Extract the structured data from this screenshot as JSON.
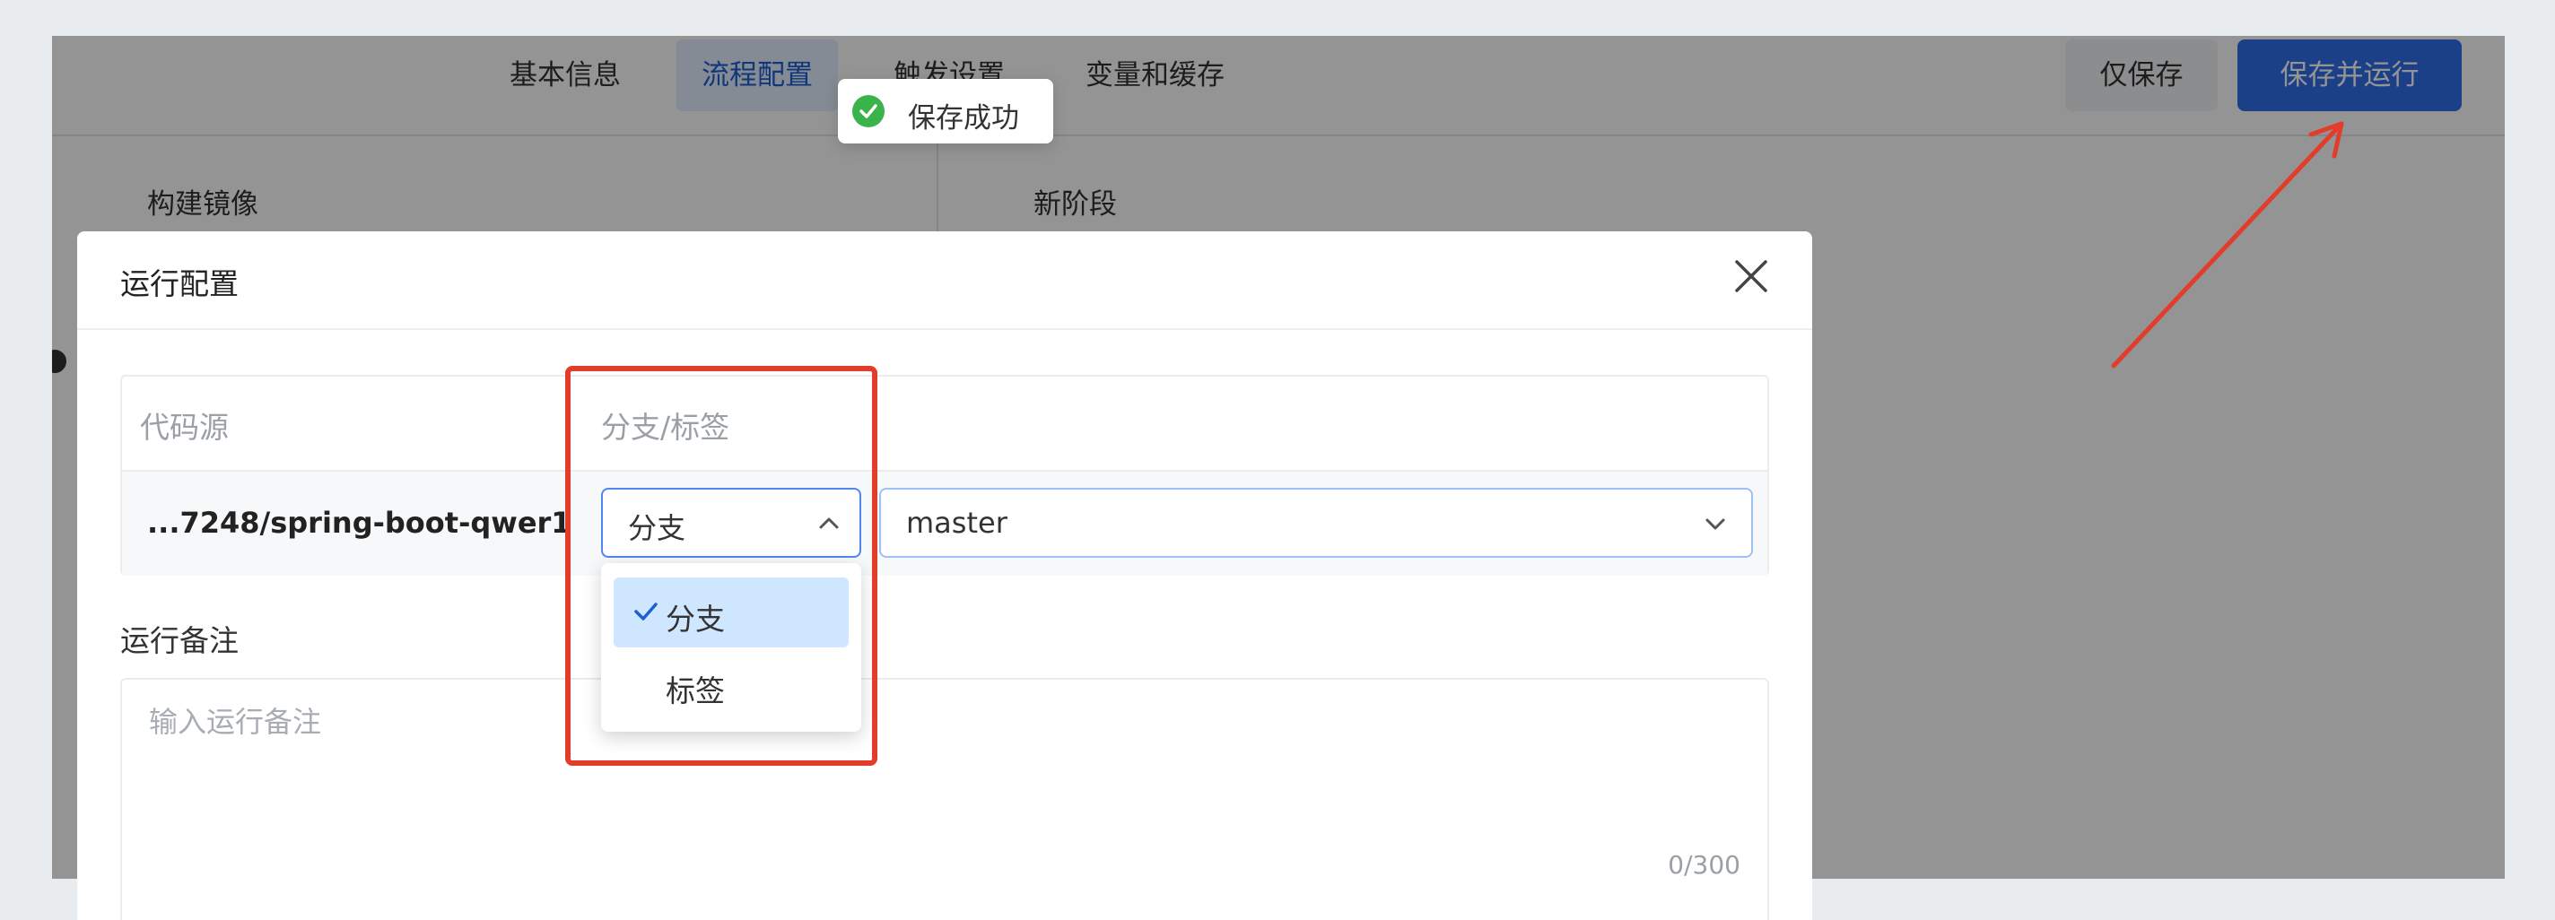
{
  "topbar": {
    "tabs": [
      {
        "label": "基本信息"
      },
      {
        "label": "流程配置"
      },
      {
        "label": "触发设置"
      },
      {
        "label": "变量和缓存"
      }
    ],
    "save_only": "仅保存",
    "save_and_run": "保存并运行"
  },
  "canvas": {
    "column1_title": "构建镜像",
    "column2_title": "新阶段"
  },
  "toast": {
    "text": "保存成功",
    "icon": "check-circle-icon",
    "color": "#3ab34a"
  },
  "modal": {
    "title": "运行配置",
    "table": {
      "headers": [
        "代码源",
        "分支/标签"
      ],
      "repo": "...7248/spring-boot-qwer1",
      "ref_type": "分支",
      "ref_value": "master"
    },
    "dropdown_options": [
      {
        "label": "分支",
        "selected": true
      },
      {
        "label": "标签",
        "selected": false
      }
    ],
    "note_label": "运行备注",
    "note_placeholder": "输入运行备注",
    "note_counter": "0/300"
  },
  "colors": {
    "primary": "#2f6fea",
    "annotation": "#e23c2a",
    "selected_option": "#cfe6ff"
  }
}
